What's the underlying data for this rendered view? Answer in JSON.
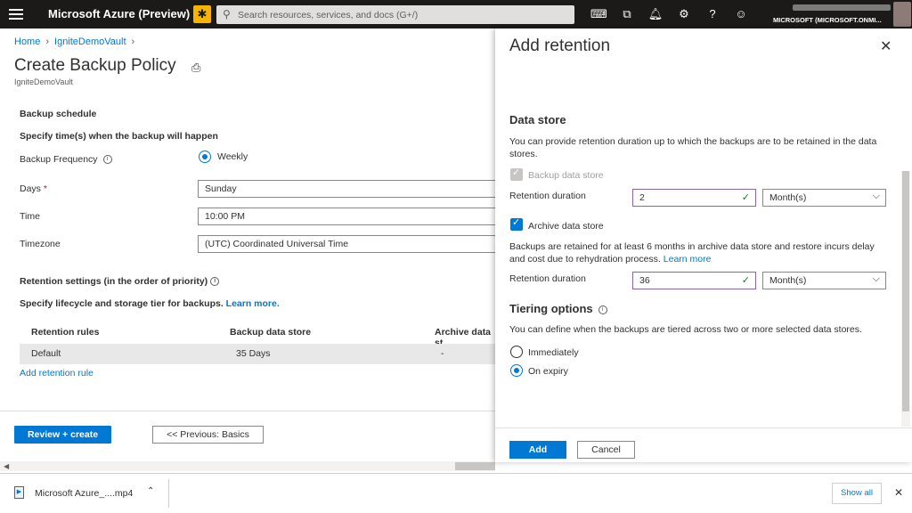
{
  "topbar": {
    "brand": "Microsoft Azure (Preview)",
    "search_placeholder": "Search resources, services, and docs (G+/)",
    "account": "MICROSOFT (MICROSOFT.ONMI..."
  },
  "breadcrumb": [
    "Home",
    "IgniteDemoVault"
  ],
  "page": {
    "title": "Create Backup Policy",
    "subtitle": "IgniteDemoVault"
  },
  "form": {
    "backup_schedule": "Backup schedule",
    "specify_time": "Specify time(s) when the backup will happen",
    "backup_frequency_label": "Backup Frequency",
    "backup_frequency_value": "Weekly",
    "days_label": "Days",
    "days_value": "Sunday",
    "time_label": "Time",
    "time_value": "10:00 PM",
    "timezone_label": "Timezone",
    "timezone_value": "(UTC) Coordinated Universal Time",
    "retention_settings": "Retention settings (in the order of priority)",
    "lifecycle_text": "Specify lifecycle and storage tier for backups.",
    "learn_more": "Learn more."
  },
  "table": {
    "headers": [
      "Retention rules",
      "Backup data store",
      "Archive data st"
    ],
    "rows": [
      [
        "Default",
        "35 Days",
        "-"
      ]
    ],
    "add_rule": "Add retention rule"
  },
  "footer": {
    "review_create": "Review + create",
    "previous": "<< Previous: Basics"
  },
  "panel": {
    "title": "Add retention",
    "data_store_title": "Data store",
    "data_store_desc": "You can provide retention duration up to which the backups are to be retained in the data stores.",
    "backup_store_label": "Backup data store",
    "retention_duration_label": "Retention duration",
    "backup_duration": "2",
    "backup_unit": "Month(s)",
    "archive_store_label": "Archive data store",
    "archive_desc": "Backups are retained for at least 6 months in archive data store and restore incurs delay and cost due to rehydration process.",
    "archive_learn_more": "Learn more",
    "archive_duration": "36",
    "archive_unit": "Month(s)",
    "tiering_title": "Tiering options",
    "tiering_desc": "You can define when the backups are tiered across two or more selected data stores.",
    "opt_immediately": "Immediately",
    "opt_on_expiry": "On expiry",
    "add_button": "Add",
    "cancel_button": "Cancel"
  },
  "downloads": {
    "file_name": "Microsoft Azure_....mp4",
    "show_all": "Show all"
  },
  "colors": {
    "accent": "#0078d4",
    "topbar": "#1b1a19"
  }
}
